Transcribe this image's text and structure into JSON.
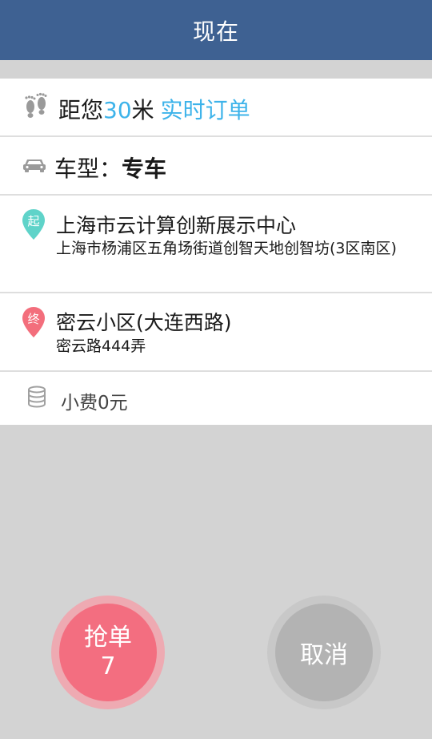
{
  "header": {
    "title": "现在"
  },
  "distance": {
    "prefix": "距您",
    "value": "30",
    "unit": "米",
    "tag": "实时订单"
  },
  "car_type": {
    "label": "车型：",
    "value": "专车"
  },
  "start": {
    "badge": "起",
    "name": "上海市云计算创新展示中心",
    "address": "上海市杨浦区五角场街道创智天地创智坊(3区南区)"
  },
  "end": {
    "badge": "终",
    "name": "密云小区(大连西路)",
    "address": "密云路444弄"
  },
  "tip": {
    "text": "小费0元"
  },
  "actions": {
    "grab_label": "抢单",
    "grab_count": "7",
    "cancel_label": "取消"
  },
  "colors": {
    "header_bg": "#3e6192",
    "accent_blue": "#3db3ea",
    "start_pin": "#5fd3c9",
    "end_pin": "#f36e7c",
    "grab_button": "#f36e80",
    "cancel_button": "#b3b3b3"
  },
  "icons": [
    "footprints-icon",
    "car-icon",
    "start-pin-icon",
    "end-pin-icon",
    "coins-icon"
  ]
}
